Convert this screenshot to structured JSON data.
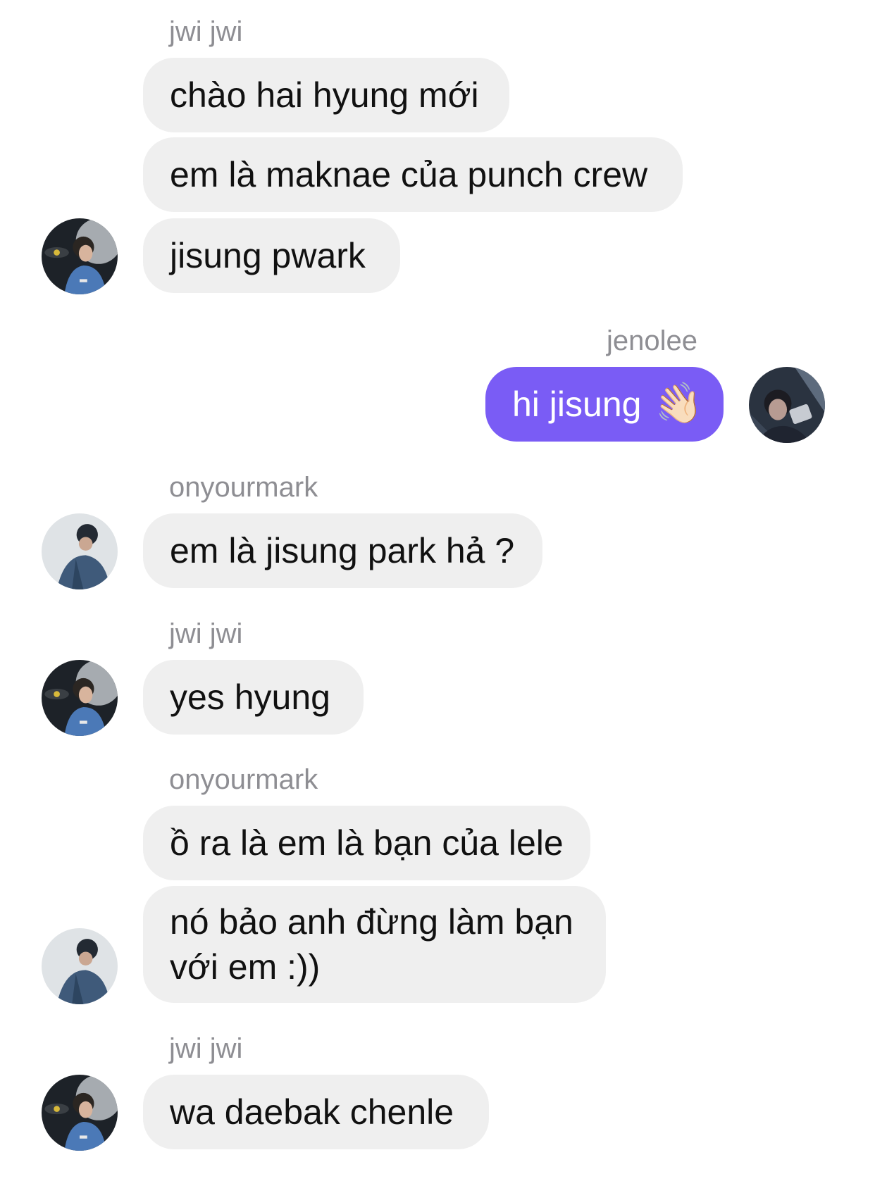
{
  "colors": {
    "incoming_bubble": "#efefef",
    "outgoing_bubble": "#7a5cf5",
    "sender_name": "#8e8e93"
  },
  "chat": {
    "groups": [
      {
        "sender": "jwi jwi",
        "messages": [
          "chào hai hyung mới",
          "em là maknae của punch crew",
          "jisung pwark"
        ],
        "avatar": "avatar-jwi"
      },
      {
        "sender": "jenolee",
        "messages": [
          "hi jisung"
        ],
        "emoji": "👋🏻",
        "avatar": "avatar-jenolee"
      },
      {
        "sender": "onyourmark",
        "messages": [
          "em là jisung park hả ?"
        ],
        "avatar": "avatar-onyourmark"
      },
      {
        "sender": "jwi jwi",
        "messages": [
          "yes hyung"
        ],
        "avatar": "avatar-jwi"
      },
      {
        "sender": "onyourmark",
        "messages": [
          "ồ ra là em là bạn của lele",
          "nó bảo anh đừng làm bạn với em :))"
        ],
        "avatar": "avatar-onyourmark"
      },
      {
        "sender": "jwi jwi",
        "messages": [
          "wa daebak chenle"
        ],
        "avatar": "avatar-jwi"
      }
    ]
  }
}
